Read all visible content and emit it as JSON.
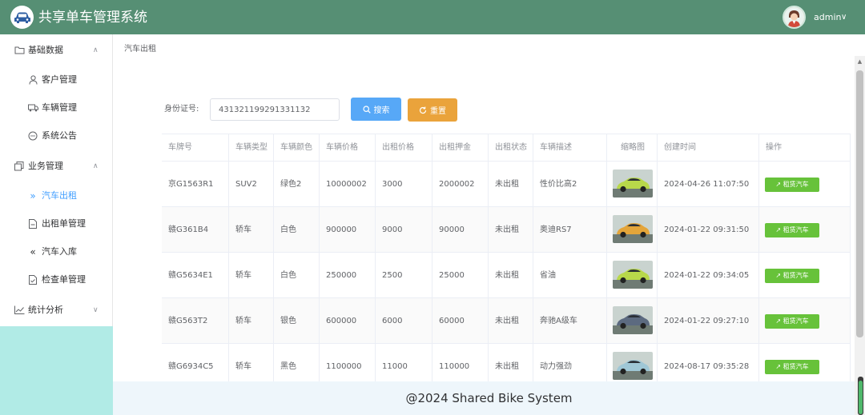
{
  "header": {
    "app_title": "共享单车管理系统",
    "user": "admin",
    "user_chevron": "∨"
  },
  "sidebar": {
    "items": [
      {
        "label": "基础数据",
        "icon": "folder-icon",
        "group": true,
        "chevron": "∧"
      },
      {
        "label": "客户管理",
        "icon": "user-icon"
      },
      {
        "label": "车辆管理",
        "icon": "truck-icon"
      },
      {
        "label": "系统公告",
        "icon": "chat-icon"
      },
      {
        "label": "业务管理",
        "icon": "copy-icon",
        "group": true,
        "chevron": "∧"
      },
      {
        "label": "汽车出租",
        "icon": "double-arrow-right-icon",
        "active": true
      },
      {
        "label": "出租单管理",
        "icon": "document-icon"
      },
      {
        "label": "汽车入库",
        "icon": "double-arrow-left-icon"
      },
      {
        "label": "检查单管理",
        "icon": "checked-document-icon"
      },
      {
        "label": "统计分析",
        "icon": "chart-icon",
        "group": true,
        "chevron": "∨"
      }
    ]
  },
  "breadcrumb": "汽车出租",
  "search": {
    "label": "身份证号:",
    "value": "431321199291331132",
    "search_button": "搜索",
    "reset_button": "重置"
  },
  "table": {
    "headers": [
      "车牌号",
      "车辆类型",
      "车辆颜色",
      "车辆价格",
      "出租价格",
      "出租押金",
      "出租状态",
      "车辆描述",
      "缩略图",
      "创建时间",
      "操作"
    ],
    "rows": [
      {
        "plate": "京G1563R1",
        "type": "SUV2",
        "color": "绿色2",
        "price": "10000002",
        "rent": "3000",
        "deposit": "2000002",
        "status": "未出租",
        "desc": "性价比高2",
        "thumb_color": "#b8d84a",
        "created": "2024-04-26 11:07:50",
        "action": "租赁汽车"
      },
      {
        "plate": "赣G361B4",
        "type": "轿车",
        "color": "白色",
        "price": "900000",
        "rent": "9000",
        "deposit": "90000",
        "status": "未出租",
        "desc": "奥迪RS7",
        "thumb_color": "#e4a53a",
        "created": "2024-01-22 09:31:50",
        "action": "租赁汽车"
      },
      {
        "plate": "赣G5634E1",
        "type": "轿车",
        "color": "白色",
        "price": "250000",
        "rent": "2500",
        "deposit": "25000",
        "status": "未出租",
        "desc": "省油",
        "thumb_color": "#b8d84a",
        "created": "2024-01-22 09:34:05",
        "action": "租赁汽车"
      },
      {
        "plate": "赣G563T2",
        "type": "轿车",
        "color": "银色",
        "price": "600000",
        "rent": "6000",
        "deposit": "60000",
        "status": "未出租",
        "desc": "奔驰A级车",
        "thumb_color": "#5c6a80",
        "created": "2024-01-22 09:27:10",
        "action": "租赁汽车"
      },
      {
        "plate": "赣G6934C5",
        "type": "轿车",
        "color": "黑色",
        "price": "1100000",
        "rent": "11000",
        "deposit": "110000",
        "status": "未出租",
        "desc": "动力强劲",
        "thumb_color": "#9fc7d6",
        "created": "2024-08-17 09:35:28",
        "action": "租赁汽车"
      }
    ]
  },
  "footer": "@2024 Shared Bike System",
  "colors": {
    "header_bg": "#568f74",
    "active_menu": "#409eff",
    "search_button": "#57a8f7",
    "reset_button": "#eaa33b",
    "rent_button": "#67c23a"
  }
}
